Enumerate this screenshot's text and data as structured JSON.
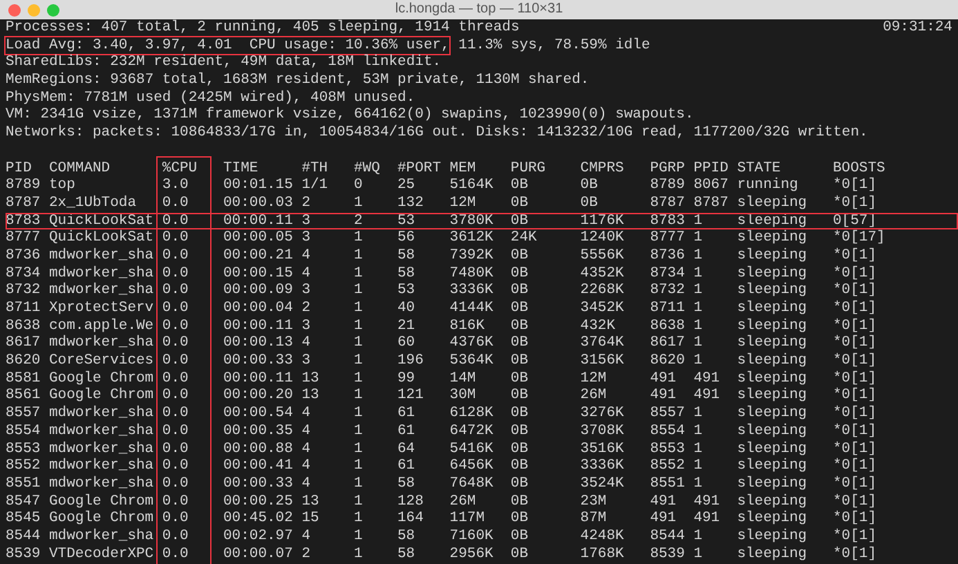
{
  "window": {
    "title": "lc.hongda — top — 110×31"
  },
  "clock": "09:31:24",
  "summary": [
    [
      {
        "text": "Processes: 407 total, 2 running, 405 sleeping, 1914 threads",
        "highlighted": false
      }
    ],
    [
      {
        "text": "Load Avg: 3.40, 3.97, 4.01  CPU usage: 10.36% user,",
        "highlighted": true
      },
      {
        "text": " 11.3% sys, 78.59% idle",
        "highlighted": false
      }
    ],
    [
      {
        "text": "SharedLibs: 232M resident, 49M data, 18M linkedit.",
        "highlighted": false
      }
    ],
    [
      {
        "text": "MemRegions: 93687 total, 1683M resident, 53M private, 1130M shared.",
        "highlighted": false
      }
    ],
    [
      {
        "text": "PhysMem: 7781M used (2425M wired), 408M unused.",
        "highlighted": false
      }
    ],
    [
      {
        "text": "VM: 2341G vsize, 1371M framework vsize, 664162(0) swapins, 1023990(0) swapouts.",
        "highlighted": false
      }
    ],
    [
      {
        "text": "Networks: packets: 10864833/17G in, 10054834/16G out. Disks: 1413232/10G read, 1177200/32G written.",
        "highlighted": false
      }
    ]
  ],
  "table": {
    "columns": [
      {
        "label": "PID",
        "highlighted": false
      },
      {
        "label": "COMMAND",
        "highlighted": false
      },
      {
        "label": "%CPU",
        "highlighted": true
      },
      {
        "label": "TIME",
        "highlighted": false
      },
      {
        "label": "#TH",
        "highlighted": false
      },
      {
        "label": "#WQ",
        "highlighted": false
      },
      {
        "label": "#PORT",
        "highlighted": false
      },
      {
        "label": "MEM",
        "highlighted": false
      },
      {
        "label": "PURG",
        "highlighted": false
      },
      {
        "label": "CMPRS",
        "highlighted": false
      },
      {
        "label": "PGRP",
        "highlighted": false
      },
      {
        "label": "PPID",
        "highlighted": false
      },
      {
        "label": "STATE",
        "highlighted": false
      },
      {
        "label": "BOOSTS",
        "highlighted": false
      }
    ],
    "rows": [
      {
        "highlighted": false,
        "cells": [
          "8789",
          "top",
          "3.0",
          "00:01.15",
          "1/1",
          "0",
          "25",
          "5164K",
          "0B",
          "0B",
          "8789",
          "8067",
          "running",
          "*0[1]"
        ]
      },
      {
        "highlighted": false,
        "cells": [
          "8787",
          "2x_1UbToda",
          "0.0",
          "00:00.03",
          "2",
          "1",
          "132",
          "12M",
          "0B",
          "0B",
          "8787",
          "8787",
          "sleeping",
          "*0[1]"
        ]
      },
      {
        "highlighted": true,
        "cells": [
          "8783",
          "QuickLookSat",
          "0.0",
          "00:00.11",
          "3",
          "2",
          "53",
          "3780K",
          "0B",
          "1176K",
          "8783",
          "1",
          "sleeping",
          "0[57]"
        ]
      },
      {
        "highlighted": false,
        "cells": [
          "8777",
          "QuickLookSat",
          "0.0",
          "00:00.05",
          "3",
          "1",
          "56",
          "3612K",
          "24K",
          "1240K",
          "8777",
          "1",
          "sleeping",
          "*0[17]"
        ]
      },
      {
        "highlighted": false,
        "cells": [
          "8736",
          "mdworker_sha",
          "0.0",
          "00:00.21",
          "4",
          "1",
          "58",
          "7392K",
          "0B",
          "5556K",
          "8736",
          "1",
          "sleeping",
          "*0[1]"
        ]
      },
      {
        "highlighted": false,
        "cells": [
          "8734",
          "mdworker_sha",
          "0.0",
          "00:00.15",
          "4",
          "1",
          "58",
          "7480K",
          "0B",
          "4352K",
          "8734",
          "1",
          "sleeping",
          "*0[1]"
        ]
      },
      {
        "highlighted": false,
        "cells": [
          "8732",
          "mdworker_sha",
          "0.0",
          "00:00.09",
          "3",
          "1",
          "53",
          "3336K",
          "0B",
          "2268K",
          "8732",
          "1",
          "sleeping",
          "*0[1]"
        ]
      },
      {
        "highlighted": false,
        "cells": [
          "8711",
          "XprotectServ",
          "0.0",
          "00:00.04",
          "2",
          "1",
          "40",
          "4144K",
          "0B",
          "3452K",
          "8711",
          "1",
          "sleeping",
          "*0[1]"
        ]
      },
      {
        "highlighted": false,
        "cells": [
          "8638",
          "com.apple.We",
          "0.0",
          "00:00.11",
          "3",
          "1",
          "21",
          "816K",
          "0B",
          "432K",
          "8638",
          "1",
          "sleeping",
          "*0[1]"
        ]
      },
      {
        "highlighted": false,
        "cells": [
          "8617",
          "mdworker_sha",
          "0.0",
          "00:00.13",
          "4",
          "1",
          "60",
          "4376K",
          "0B",
          "3764K",
          "8617",
          "1",
          "sleeping",
          "*0[1]"
        ]
      },
      {
        "highlighted": false,
        "cells": [
          "8620",
          "CoreServices",
          "0.0",
          "00:00.33",
          "3",
          "1",
          "196",
          "5364K",
          "0B",
          "3156K",
          "8620",
          "1",
          "sleeping",
          "*0[1]"
        ]
      },
      {
        "highlighted": false,
        "cells": [
          "8581",
          "Google Chrom",
          "0.0",
          "00:00.11",
          "13",
          "1",
          "99",
          "14M",
          "0B",
          "12M",
          "491",
          "491",
          "sleeping",
          "*0[1]"
        ]
      },
      {
        "highlighted": false,
        "cells": [
          "8561",
          "Google Chrom",
          "0.0",
          "00:00.20",
          "13",
          "1",
          "121",
          "30M",
          "0B",
          "26M",
          "491",
          "491",
          "sleeping",
          "*0[1]"
        ]
      },
      {
        "highlighted": false,
        "cells": [
          "8557",
          "mdworker_sha",
          "0.0",
          "00:00.54",
          "4",
          "1",
          "61",
          "6128K",
          "0B",
          "3276K",
          "8557",
          "1",
          "sleeping",
          "*0[1]"
        ]
      },
      {
        "highlighted": false,
        "cells": [
          "8554",
          "mdworker_sha",
          "0.0",
          "00:00.35",
          "4",
          "1",
          "61",
          "6472K",
          "0B",
          "3708K",
          "8554",
          "1",
          "sleeping",
          "*0[1]"
        ]
      },
      {
        "highlighted": false,
        "cells": [
          "8553",
          "mdworker_sha",
          "0.0",
          "00:00.88",
          "4",
          "1",
          "64",
          "5416K",
          "0B",
          "3516K",
          "8553",
          "1",
          "sleeping",
          "*0[1]"
        ]
      },
      {
        "highlighted": false,
        "cells": [
          "8552",
          "mdworker_sha",
          "0.0",
          "00:00.41",
          "4",
          "1",
          "61",
          "6456K",
          "0B",
          "3336K",
          "8552",
          "1",
          "sleeping",
          "*0[1]"
        ]
      },
      {
        "highlighted": false,
        "cells": [
          "8551",
          "mdworker_sha",
          "0.0",
          "00:00.33",
          "4",
          "1",
          "58",
          "7648K",
          "0B",
          "3524K",
          "8551",
          "1",
          "sleeping",
          "*0[1]"
        ]
      },
      {
        "highlighted": false,
        "cells": [
          "8547",
          "Google Chrom",
          "0.0",
          "00:00.25",
          "13",
          "1",
          "128",
          "26M",
          "0B",
          "23M",
          "491",
          "491",
          "sleeping",
          "*0[1]"
        ]
      },
      {
        "highlighted": false,
        "cells": [
          "8545",
          "Google Chrom",
          "0.0",
          "00:45.02",
          "15",
          "1",
          "164",
          "117M",
          "0B",
          "87M",
          "491",
          "491",
          "sleeping",
          "*0[1]"
        ]
      },
      {
        "highlighted": false,
        "cells": [
          "8544",
          "mdworker_sha",
          "0.0",
          "00:02.97",
          "4",
          "1",
          "58",
          "7160K",
          "0B",
          "4248K",
          "8544",
          "1",
          "sleeping",
          "*0[1]"
        ]
      },
      {
        "highlighted": false,
        "cells": [
          "8539",
          "VTDecoderXPC",
          "0.0",
          "00:00.07",
          "2",
          "1",
          "58",
          "2956K",
          "0B",
          "1768K",
          "8539",
          "1",
          "sleeping",
          "*0[1]"
        ]
      }
    ]
  }
}
